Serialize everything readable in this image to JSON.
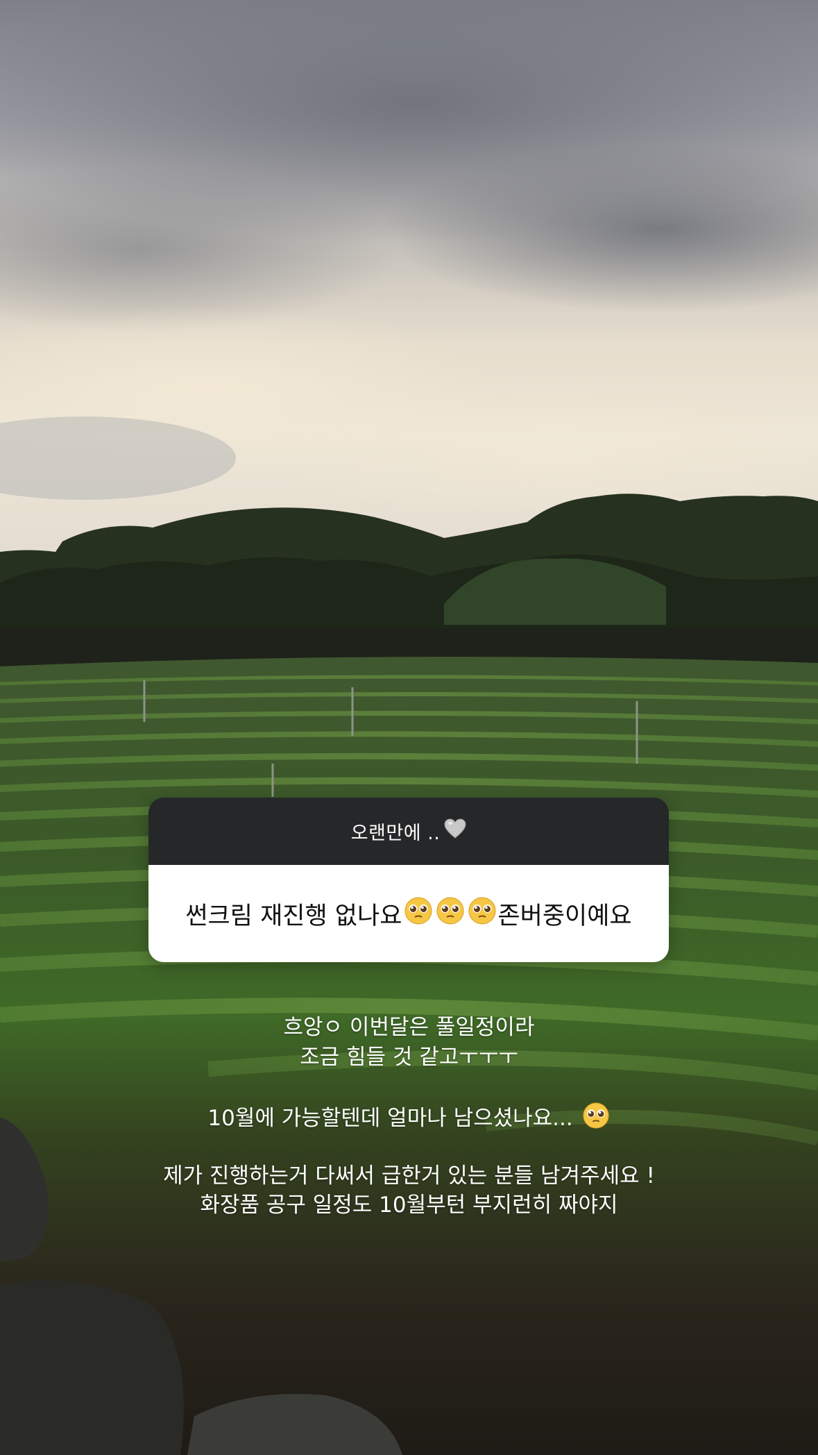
{
  "question_sticker": {
    "prompt": "오랜만에 ..",
    "prompt_icon": "grey-heart-icon",
    "answer_text": "썬크림 재진행 없나요",
    "answer_icons": [
      "pleading-face-icon",
      "pleading-face-icon",
      "pleading-face-icon"
    ],
    "answer_suffix": "존버중이예요"
  },
  "reply": {
    "line1": "흐앙ㅇ 이번달은 풀일정이라",
    "line2": "조금 힘들 것 같고ㅜㅜㅜ",
    "line3": "10월에 가능할텐데 얼마나 남으셨나요...",
    "line3_icon": "pleading-face-icon",
    "line4": "제가 진행하는거 다써서 급한거 있는 분들 남겨주세요 !",
    "line5": "화장품 공구 일정도 10월부턴 부지런히 짜야지"
  },
  "colors": {
    "sticker_header": "#262729",
    "sticker_body": "#ffffff",
    "reply_text": "#ffffff"
  }
}
